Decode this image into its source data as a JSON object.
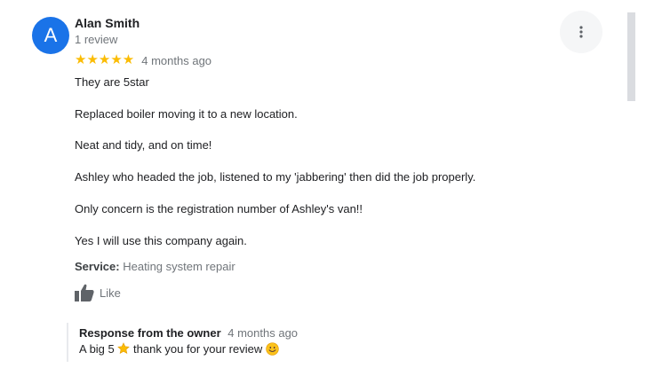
{
  "review": {
    "avatar_letter": "A",
    "author": "Alan Smith",
    "author_reviews": "1 review",
    "stars": "★★★★★",
    "rating": 5,
    "time": "4 months ago",
    "paragraphs": [
      "They are 5star",
      "Replaced boiler moving it to a new location.",
      "Neat and tidy, and on time!",
      "Ashley who headed the job, listened to my 'jabbering' then did the job properly.",
      "Only concern is the registration number of Ashley's van!!",
      "Yes I will use this company again."
    ],
    "service_label": "Service:",
    "service_value": "Heating system repair",
    "like_label": "Like"
  },
  "owner_response": {
    "title": "Response from the owner",
    "time": "4 months ago",
    "text_before": "A big 5",
    "text_after": "thank you for your review"
  },
  "colors": {
    "avatar": "#1a73e8",
    "star": "#fbbc04",
    "muted": "#70757a"
  }
}
